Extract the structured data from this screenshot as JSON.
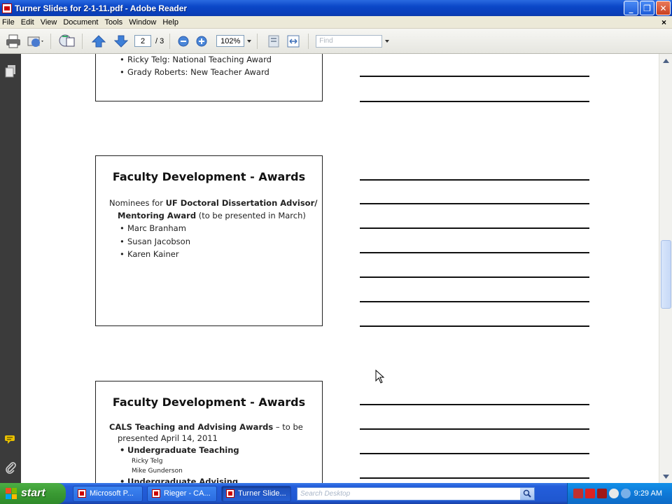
{
  "window": {
    "title": "Turner Slides for 2-1-11.pdf - Adobe Reader",
    "minimize": "_",
    "maximize": "❐",
    "close": "✕"
  },
  "menu": {
    "items": [
      "File",
      "Edit",
      "View",
      "Document",
      "Tools",
      "Window",
      "Help"
    ],
    "close_doc": "×"
  },
  "toolbar": {
    "page_current": "2",
    "page_total": "/ 3",
    "zoom": "102%",
    "find_placeholder": "Find"
  },
  "slides": {
    "s1": {
      "bullet1": "Ricky Telg: National Teaching Award",
      "bullet2": "Grady Roberts: New Teacher Award"
    },
    "s2": {
      "title": "Faculty Development - Awards",
      "line1_pre": "Nominees for ",
      "line1_bold": "UF Doctoral Dissertation Advisor/",
      "line2_bold": "Mentoring Award",
      "line2_post": " (to be presented in March)",
      "bullets": [
        "Marc Branham",
        "Susan Jacobson",
        "Karen Kainer"
      ]
    },
    "s3": {
      "title": "Faculty Development - Awards",
      "line1_bold": "CALS Teaching and Advising Awards",
      "line1_post": " – to be",
      "line2": "presented April 14, 2011",
      "bullet1": "Undergraduate Teaching",
      "sub1": "Ricky Telg",
      "sub2": "Mike Gunderson",
      "bullet2": "Undergraduate Advising"
    }
  },
  "taskbar": {
    "start": "start",
    "tasks": [
      "Microsoft P...",
      "Rieger - CA...",
      "Turner Slide..."
    ],
    "search_placeholder": "Search Desktop",
    "clock": "9:29 AM"
  }
}
